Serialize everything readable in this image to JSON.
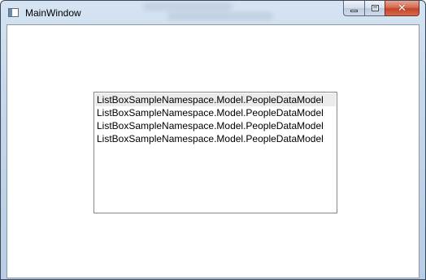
{
  "window": {
    "title": "MainWindow",
    "icon": "app-window-icon",
    "caption_buttons": {
      "minimize_icon": "minimize-icon",
      "maximize_icon": "maximize-icon",
      "close_icon": "close-icon",
      "close_glyph": "✕"
    },
    "close_color": "#c2432a"
  },
  "listbox": {
    "items": [
      {
        "label": "ListBoxSampleNamespace.Model.PeopleDataModel",
        "hovered": true
      },
      {
        "label": "ListBoxSampleNamespace.Model.PeopleDataModel",
        "hovered": false
      },
      {
        "label": "ListBoxSampleNamespace.Model.PeopleDataModel",
        "hovered": false
      },
      {
        "label": "ListBoxSampleNamespace.Model.PeopleDataModel",
        "hovered": false
      }
    ]
  }
}
